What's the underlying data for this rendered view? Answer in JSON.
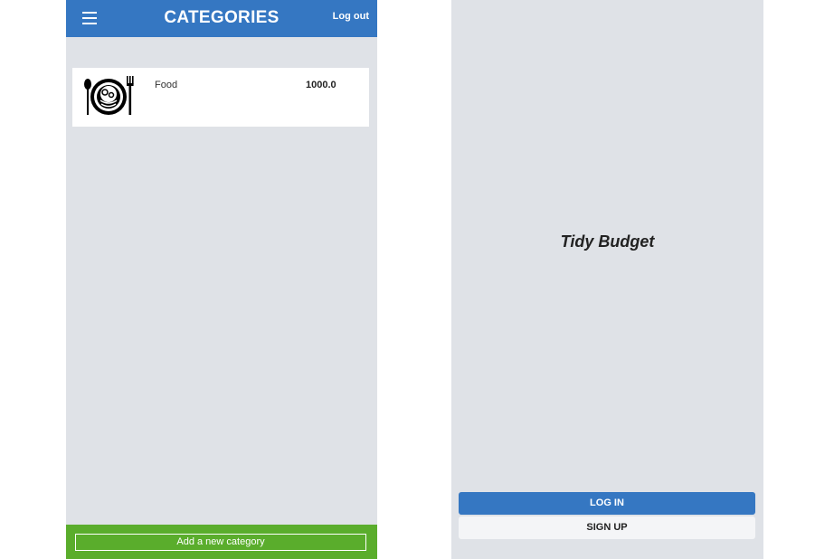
{
  "categories_screen": {
    "header": {
      "title": "CATEGORIES",
      "logout_label": "Log out",
      "menu_icon": "hamburger-menu-icon"
    },
    "categories": [
      {
        "icon": "plate-fork-spoon-icon",
        "name": "Food",
        "amount": "1000.0"
      }
    ],
    "footer": {
      "add_label": "Add a new category"
    }
  },
  "welcome_screen": {
    "app_title": "Tidy Budget",
    "login_label": "LOG IN",
    "signup_label": "SIGN UP"
  },
  "colors": {
    "header_blue": "#3577c2",
    "footer_green": "#5aad2c",
    "screen_bg": "#dfe2e7"
  }
}
